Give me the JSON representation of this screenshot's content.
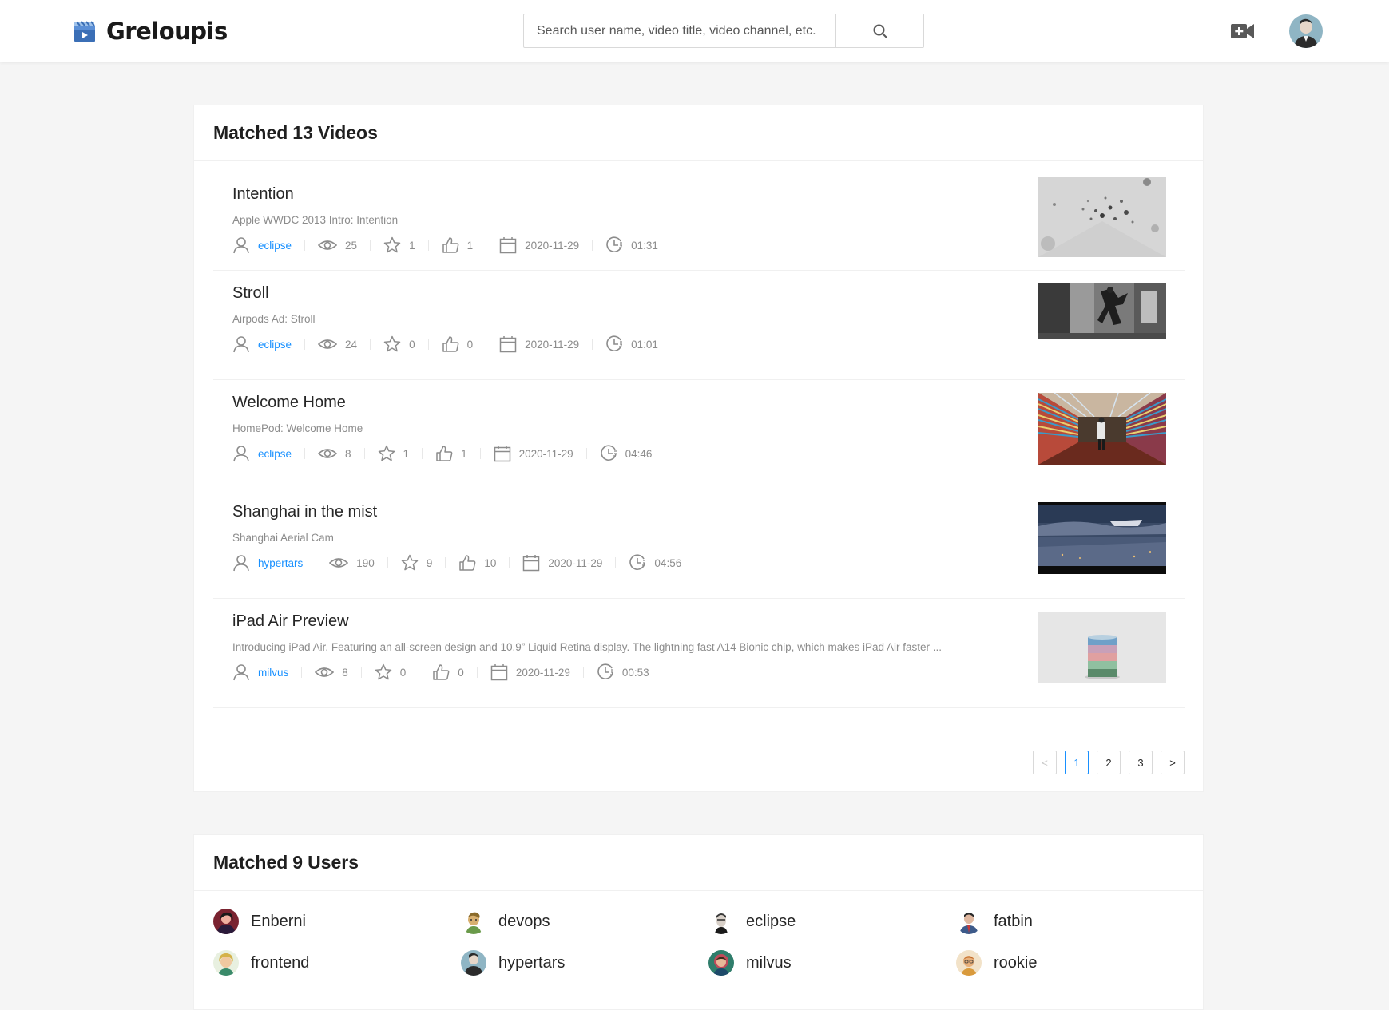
{
  "header": {
    "brand": "Greloupis",
    "search_placeholder": "Search user name, video title, video channel, etc."
  },
  "videos_card": {
    "title_prefix": "Matched",
    "count": "13",
    "title_suffix": "Videos",
    "items": [
      {
        "title": "Intention",
        "desc": "Apple WWDC 2013 Intro: Intention",
        "user": "eclipse",
        "views": "25",
        "stars": "1",
        "likes": "1",
        "date": "2020-11-29",
        "duration": "01:31",
        "thumb": "gray-particles"
      },
      {
        "title": "Stroll",
        "desc": "Airpods Ad: Stroll",
        "user": "eclipse",
        "views": "24",
        "stars": "0",
        "likes": "0",
        "date": "2020-11-29",
        "duration": "01:01",
        "thumb": "bw-dancer"
      },
      {
        "title": "Welcome Home",
        "desc": "HomePod: Welcome Home",
        "user": "eclipse",
        "views": "8",
        "stars": "1",
        "likes": "1",
        "date": "2020-11-29",
        "duration": "04:46",
        "thumb": "color-stripes-room"
      },
      {
        "title": "Shanghai in the mist",
        "desc": "Shanghai Aerial Cam",
        "user": "hypertars",
        "views": "190",
        "stars": "9",
        "likes": "10",
        "date": "2020-11-29",
        "duration": "04:56",
        "thumb": "aerial-city"
      },
      {
        "title": "iPad Air Preview",
        "desc": "Introducing iPad Air. Featuring an all-screen design and 10.9” Liquid Retina display. The lightning fast A14 Bionic chip, which makes iPad Air faster ...",
        "user": "milvus",
        "views": "8",
        "stars": "0",
        "likes": "0",
        "date": "2020-11-29",
        "duration": "00:53",
        "thumb": "color-cylinder"
      }
    ],
    "pagination": {
      "prev": "<",
      "pages": [
        "1",
        "2",
        "3"
      ],
      "current": "1",
      "next": ">"
    }
  },
  "users_card": {
    "title_prefix": "Matched",
    "count": "9",
    "title_suffix": "Users",
    "users": [
      {
        "name": "Enberni",
        "avatar": "#7a2330"
      },
      {
        "name": "devops",
        "avatar": "#b08a3a"
      },
      {
        "name": "eclipse",
        "avatar": "#6b6b6b"
      },
      {
        "name": "fatbin",
        "avatar": "#3d5a8a"
      },
      {
        "name": "frontend",
        "avatar": "#d4b24a"
      },
      {
        "name": "hypertars",
        "avatar": "#4a5a66"
      },
      {
        "name": "milvus",
        "avatar": "#2f7d6b"
      },
      {
        "name": "rookie",
        "avatar": "#d99a3c"
      }
    ]
  },
  "icons": {
    "search": "search-icon",
    "upload": "video-camera-add-icon",
    "user": "user-icon",
    "views": "eye-icon",
    "stars": "star-icon",
    "likes": "like-icon",
    "date": "calendar-icon",
    "duration": "clock-icon"
  },
  "colors": {
    "link": "#1890ff",
    "muted": "#8c8c8c",
    "border": "#f0f0f0",
    "page_bg": "#f5f5f5"
  }
}
